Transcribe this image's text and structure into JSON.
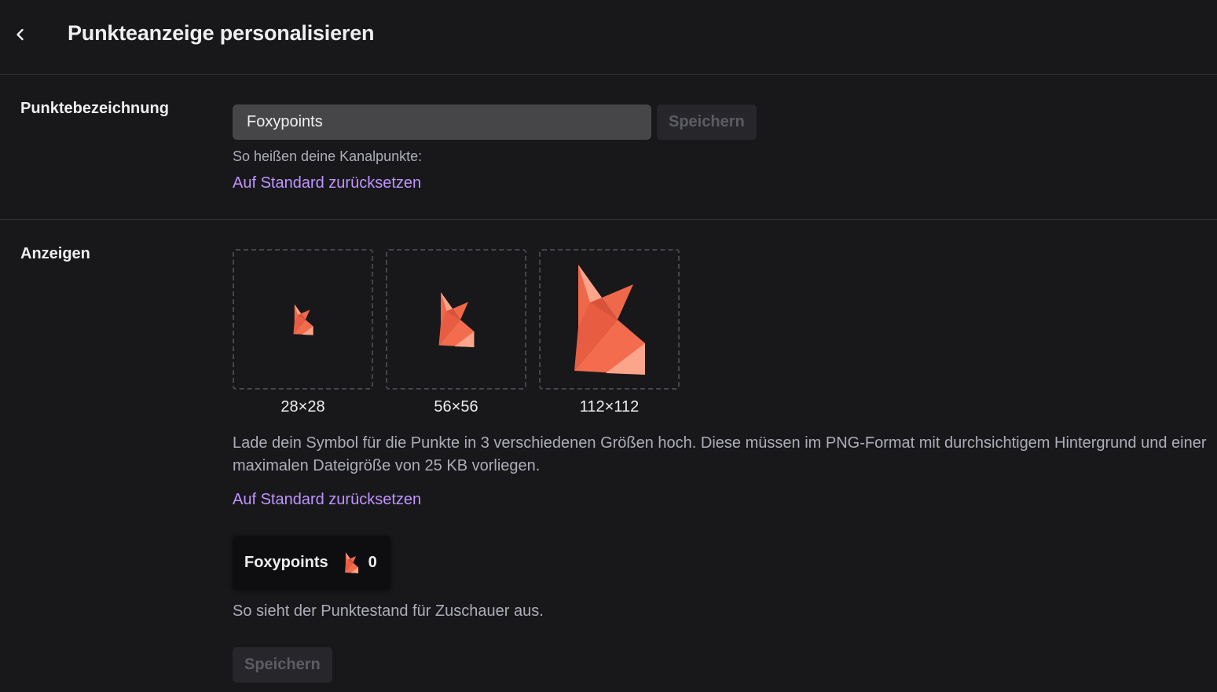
{
  "header": {
    "title": "Punkteanzeige personalisieren"
  },
  "name_section": {
    "label": "Punktebezeichnung",
    "input_value": "Foxypoints",
    "save_label": "Speichern",
    "helper_text": "So heißen deine Kanalpunkte:",
    "reset_link": "Auf Standard zurücksetzen"
  },
  "icon_section": {
    "label": "Anzeigen",
    "sizes": [
      {
        "label": "28×28"
      },
      {
        "label": "56×56"
      },
      {
        "label": "112×112"
      }
    ],
    "description": "Lade dein Symbol für die Punkte in 3 verschiedenen Größen hoch. Diese müssen im PNG-Format mit durchsichtigem Hintergrund und einer maximalen Dateigröße von 25 KB vorliegen.",
    "reset_link": "Auf Standard zurücksetzen",
    "preview": {
      "name": "Foxypoints",
      "count": "0"
    },
    "preview_caption": "So sieht der Punktestand für Zuschauer aus.",
    "save_label": "Speichern"
  },
  "colors": {
    "background": "#18181b",
    "accent_link": "#bf94ff",
    "fox_primary": "#f0684a",
    "fox_light": "#fba68a"
  },
  "icons": [
    "chevron-left-icon",
    "fox-icon"
  ]
}
